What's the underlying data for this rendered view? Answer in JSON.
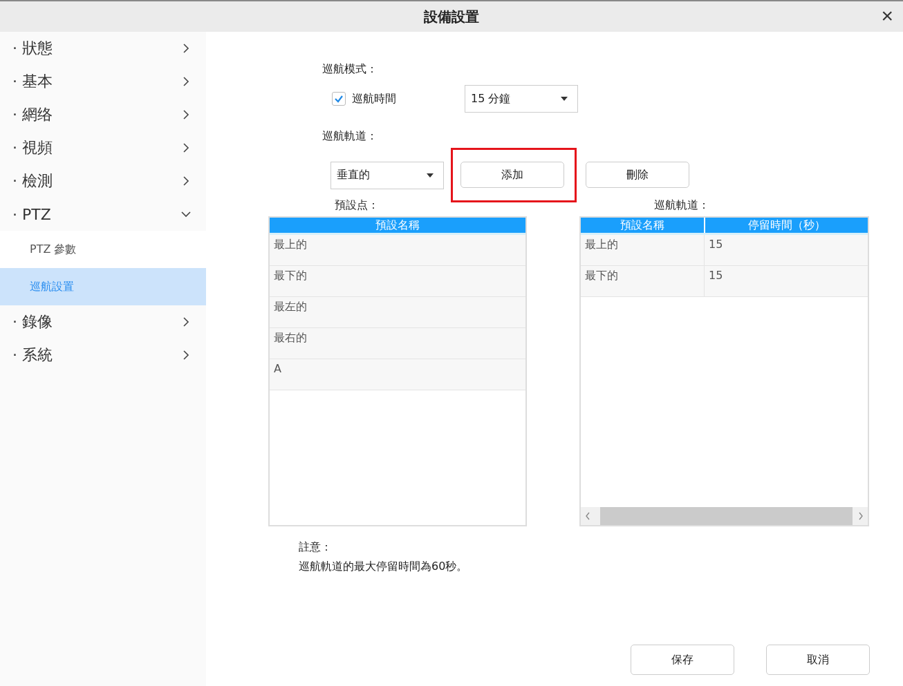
{
  "window": {
    "title": "設備設置",
    "close": "×"
  },
  "sidebar": {
    "items": [
      {
        "label": "· 狀態",
        "expanded": false
      },
      {
        "label": "· 基本",
        "expanded": false
      },
      {
        "label": "· 網络",
        "expanded": false
      },
      {
        "label": "· 視頻",
        "expanded": false
      },
      {
        "label": "· 檢測",
        "expanded": false
      },
      {
        "label": "· PTZ",
        "expanded": true,
        "children": [
          {
            "label": "PTZ 參數",
            "selected": false
          },
          {
            "label": "巡航設置",
            "selected": true
          }
        ]
      },
      {
        "label": "· 錄像",
        "expanded": false
      },
      {
        "label": "· 系統",
        "expanded": false
      }
    ]
  },
  "cruise_mode": {
    "label": "巡航模式：",
    "checkbox": {
      "label": "巡航時間",
      "checked": true
    },
    "duration": {
      "value": "15 分鐘"
    }
  },
  "cruise_track": {
    "label": "巡航軌道：",
    "select": {
      "value": "垂直的"
    },
    "buttons": [
      {
        "label": "添加",
        "highlighted": true
      },
      {
        "label": "刪除",
        "highlighted": false
      }
    ]
  },
  "presets": {
    "label": "預設点：",
    "columns": [
      "預設名稱"
    ],
    "rows": [
      [
        "最上的"
      ],
      [
        "最下的"
      ],
      [
        "最左的"
      ],
      [
        "最右的"
      ],
      [
        "A"
      ]
    ]
  },
  "track": {
    "label": "巡航軌道：",
    "columns": [
      "預設名稱",
      "停留時間（秒）"
    ],
    "rows": [
      [
        "最上的",
        "15"
      ],
      [
        "最下的",
        "15"
      ]
    ]
  },
  "note": {
    "title": "註意：",
    "text": "巡航軌道的最大停留時間為60秒。"
  },
  "footer_buttons": [
    "保存",
    "取消"
  ]
}
